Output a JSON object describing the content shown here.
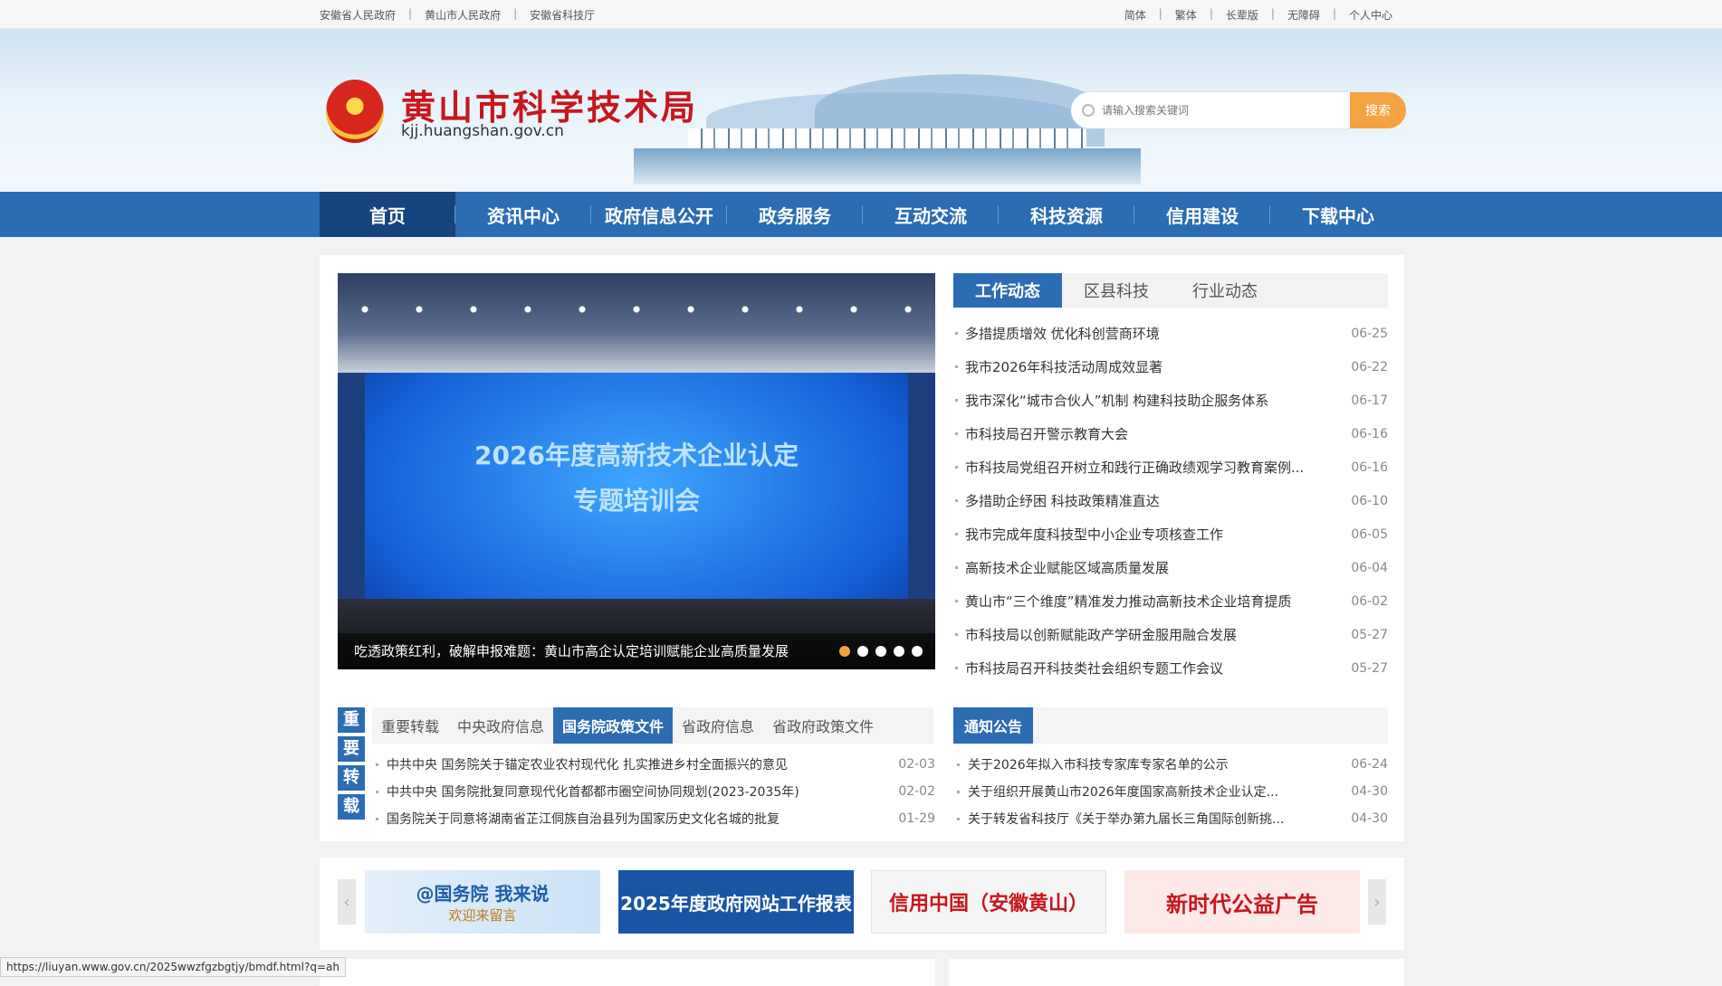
{
  "topbar": {
    "left_links": [
      "安徽省人民政府",
      "黄山市人民政府",
      "安徽省科技厅"
    ],
    "right_links": [
      "简体",
      "繁体",
      "长辈版",
      "无障碍",
      "个人中心"
    ]
  },
  "header": {
    "title": "黄山市科学技术局",
    "domain": "kjj.huangshan.gov.cn",
    "search_placeholder": "请输入搜索关键词",
    "search_button": "搜索"
  },
  "nav": {
    "items": [
      "首页",
      "资讯中心",
      "政府信息公开",
      "政务服务",
      "互动交流",
      "科技资源",
      "信用建设",
      "下载中心"
    ],
    "active_index": 0
  },
  "carousel": {
    "screen_line1": "2026年度高新技术企业认定",
    "screen_line2": "专题培训会",
    "caption": "吃透政策红利，破解申报难题：黄山市高企认定培训赋能企业高质量发展",
    "slide_count": 5,
    "active_slide": 1
  },
  "news": {
    "tabs": [
      "工作动态",
      "区县科技",
      "行业动态"
    ],
    "items": [
      {
        "title": "多措提质增效 优化科创营商环境",
        "date": "06-25"
      },
      {
        "title": "我市2026年科技活动周成效显著",
        "date": "06-22"
      },
      {
        "title": "我市深化“城市合伙人”机制 构建科技助企服务体系",
        "date": "06-17"
      },
      {
        "title": "市科技局召开警示教育大会",
        "date": "06-16"
      },
      {
        "title": "市科技局党组召开树立和践行正确政绩观学习教育案例...",
        "date": "06-16"
      },
      {
        "title": "多措助企纾困 科技政策精准直达",
        "date": "06-10"
      },
      {
        "title": "我市完成年度科技型中小企业专项核查工作",
        "date": "06-05"
      },
      {
        "title": "高新技术企业赋能区域高质量发展",
        "date": "06-04"
      },
      {
        "title": "黄山市“三个维度”精准发力推动高新技术企业培育提质",
        "date": "06-02"
      },
      {
        "title": "市科技局以创新赋能政产学研金服用融合发展",
        "date": "05-27"
      },
      {
        "title": "市科技局召开科技类社会组织专题工作会议",
        "date": "05-27"
      }
    ]
  },
  "reprint": {
    "vertical_label": [
      "重",
      "要",
      "转",
      "载"
    ],
    "tabs": [
      "重要转载",
      "中央政府信息",
      "国务院政策文件",
      "省政府信息",
      "省政府政策文件"
    ],
    "active_tab": 2,
    "items": [
      {
        "title": "中共中央 国务院关于锚定农业农村现代化 扎实推进乡村全面振兴的意见",
        "date": "02-03"
      },
      {
        "title": "中共中央 国务院批复同意现代化首都都市圈空间协同规划(2023-2035年)",
        "date": "02-02"
      },
      {
        "title": "国务院关于同意将湖南省芷江侗族自治县列为国家历史文化名城的批复",
        "date": "01-29"
      }
    ]
  },
  "notice": {
    "tab": "通知公告",
    "items": [
      {
        "title": "关于2026年拟入市科技专家库专家名单的公示",
        "date": "06-24"
      },
      {
        "title": "关于组织开展黄山市2026年度国家高新技术企业认定...",
        "date": "04-30"
      },
      {
        "title": "关于转发省科技厅《关于举办第九届长三角国际创新挑...",
        "date": "04-30"
      }
    ]
  },
  "links": {
    "ad1_main": "@国务院 我来说",
    "ad1_sub": "欢迎来留言",
    "ad2": "2025年度政府网站工作报表",
    "ad3": "信用中国（安徽黄山）",
    "ad4": "新时代公益广告"
  },
  "status_url": "https://liuyan.www.gov.cn/2025wwzfgzbgtjy/bmdf.html?q=ah",
  "colors": {
    "primary": "#2b6cb3",
    "accent": "#f3a340",
    "title_red": "#c8161d"
  }
}
